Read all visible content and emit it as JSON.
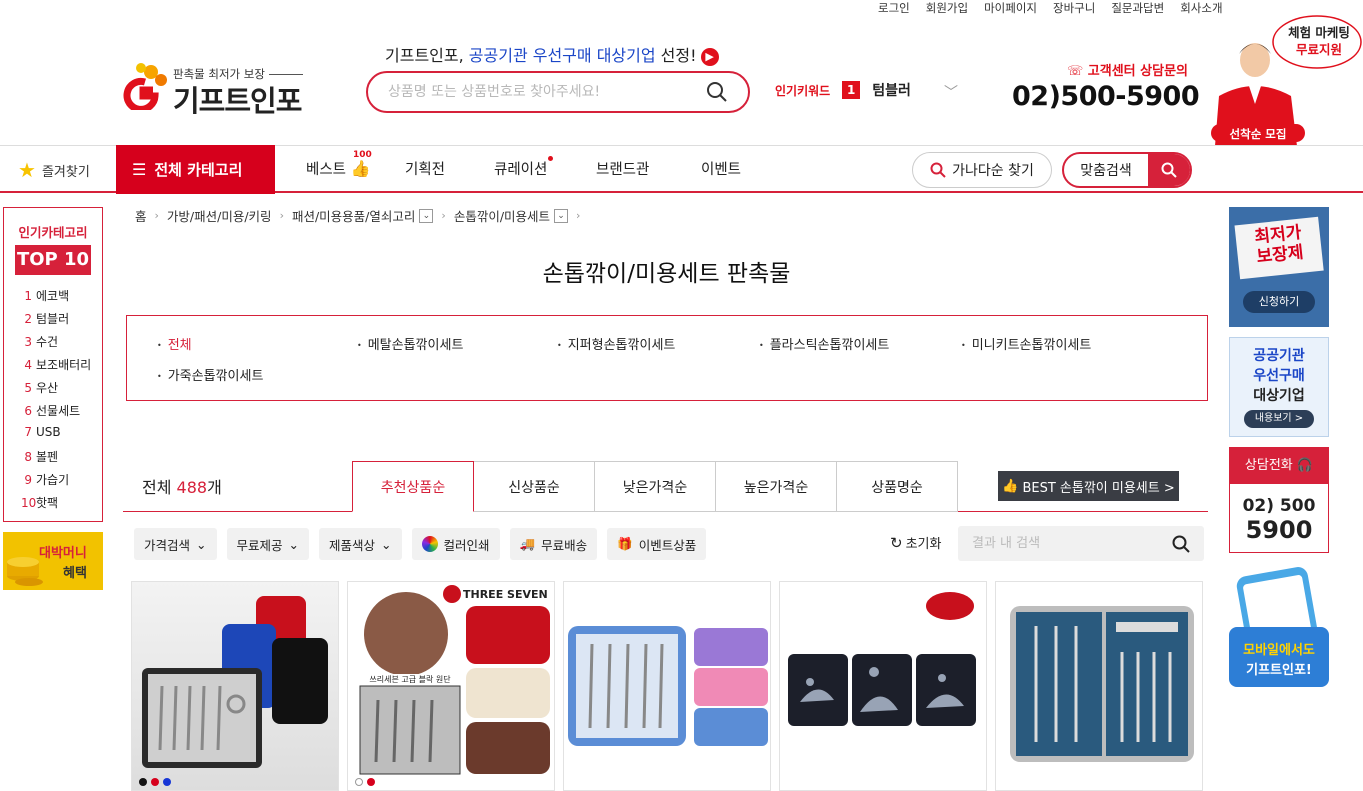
{
  "top_links": [
    "로그인",
    "회원가입",
    "마이페이지",
    "장바구니",
    "질문과답변",
    "회사소개"
  ],
  "logo": {
    "tagline": "판촉물 최저가 보장",
    "name": "기프트인포"
  },
  "headline": {
    "prefix": "기프트인포, ",
    "highlight": "공공기관 우선구매 대상기업",
    "suffix": " 선정!"
  },
  "search": {
    "placeholder": "상품명 또는 상품번호로 찾아주세요!"
  },
  "popular_keyword": {
    "label": "인기키워드",
    "rank": "1",
    "word": "텀블러"
  },
  "customer_center": {
    "label": "고객센터 상담문의",
    "phone": "02)500-5900"
  },
  "promo_badge": {
    "line1": "체험 마케팅",
    "line2": "무료지원",
    "bottom": "선착순 모집"
  },
  "nav": {
    "favorites": "즐겨찾기",
    "all_category": "전체 카테고리",
    "items": [
      "베스트",
      "기획전",
      "큐레이션",
      "브랜드관",
      "이벤트"
    ],
    "best_badge": "100",
    "ganada": "가나다순 찾기",
    "fit_search": "맞춤검색"
  },
  "left_sidebar": {
    "title": "인기카테고리",
    "badge": "TOP 10",
    "items": [
      {
        "n": "1",
        "label": "에코백"
      },
      {
        "n": "2",
        "label": "텀블러"
      },
      {
        "n": "3",
        "label": "수건"
      },
      {
        "n": "4",
        "label": "보조배터리"
      },
      {
        "n": "5",
        "label": "우산"
      },
      {
        "n": "6",
        "label": "선물세트"
      },
      {
        "n": "7",
        "label": "USB"
      },
      {
        "n": "8",
        "label": "볼펜"
      },
      {
        "n": "9",
        "label": "가습기"
      },
      {
        "n": "10",
        "label": "핫팩"
      }
    ],
    "banner_line1": "대박머니",
    "banner_line2": "혜택"
  },
  "breadcrumb": [
    "홈",
    "가방/패션/미용/키링",
    "패션/미용용품/열쇠고리",
    "손톱깎이/미용세트"
  ],
  "page_title": "손톱깎이/미용세트 판촉물",
  "subcategories": [
    "전체",
    "메탈손톱깎이세트",
    "지퍼형손톱깎이세트",
    "플라스틱손톱깎이세트",
    "미니키트손톱깎이세트",
    "가죽손톱깎이세트"
  ],
  "total": {
    "prefix": "전체 ",
    "count": "488",
    "suffix": "개"
  },
  "sort_tabs": [
    "추천상품순",
    "신상품순",
    "낮은가격순",
    "높은가격순",
    "상품명순"
  ],
  "best_button": "BEST 손톱깎이 미용세트 >",
  "filters": [
    "가격검색",
    "무료제공",
    "제품색상",
    "컬러인쇄",
    "무료배송",
    "이벤트상품"
  ],
  "reset": "초기화",
  "result_search": {
    "placeholder": "결과 내 검색"
  },
  "products": [
    {
      "name": "product-1",
      "colors": [
        "#111111",
        "#d6001c",
        "#1636d6"
      ]
    },
    {
      "name": "product-2",
      "brand": "THREE SEVEN",
      "caption": "쓰리세븐 고급 블락 원단",
      "colors": [
        "#ffffff",
        "#d6001c"
      ]
    },
    {
      "name": "product-3"
    },
    {
      "name": "product-4"
    },
    {
      "name": "product-5"
    }
  ],
  "right_sidebar": {
    "banner1_title": "최저가\n보장제",
    "banner1_btn": "신청하기",
    "banner2_lines": [
      "공공기관",
      "우선구매",
      "대상기업"
    ],
    "banner2_btn": "내용보기 >",
    "banner3_label": "상담전화",
    "banner3_phone1": "02) 500",
    "banner3_phone2": "5900",
    "banner4_line1": "모바일에서도",
    "banner4_line2": "기프트인포!"
  },
  "colors": {
    "brand_red": "#d6213a",
    "accent_blue": "#1b46c7"
  }
}
